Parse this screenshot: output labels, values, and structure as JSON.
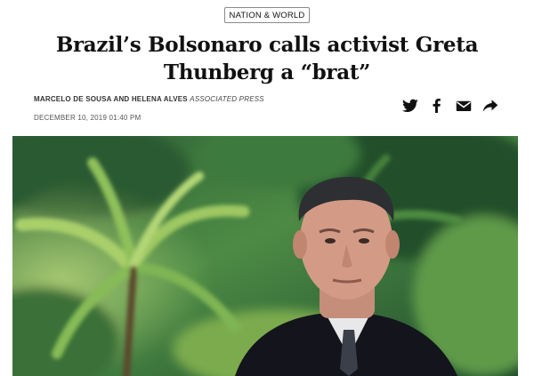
{
  "article": {
    "section_tag": "NATION & WORLD",
    "headline": "Brazil’s Bolsonaro calls activist Greta Thunberg a “brat”",
    "authors": "MARCELO DE SOUSA AND HELENA ALVES",
    "source": "ASSOCIATED PRESS",
    "date": "DECEMBER 10, 2019 01:40 PM"
  },
  "share": {
    "icons": [
      "twitter-icon",
      "facebook-icon",
      "email-icon",
      "share-arrow-icon"
    ]
  },
  "colors": {
    "text": "#111111",
    "tag_border": "#8a8a8a",
    "jungle_dark": "#1f4a2a",
    "jungle_mid": "#4f8a3c",
    "jungle_light": "#9cc36a",
    "suit": "#14141c"
  }
}
